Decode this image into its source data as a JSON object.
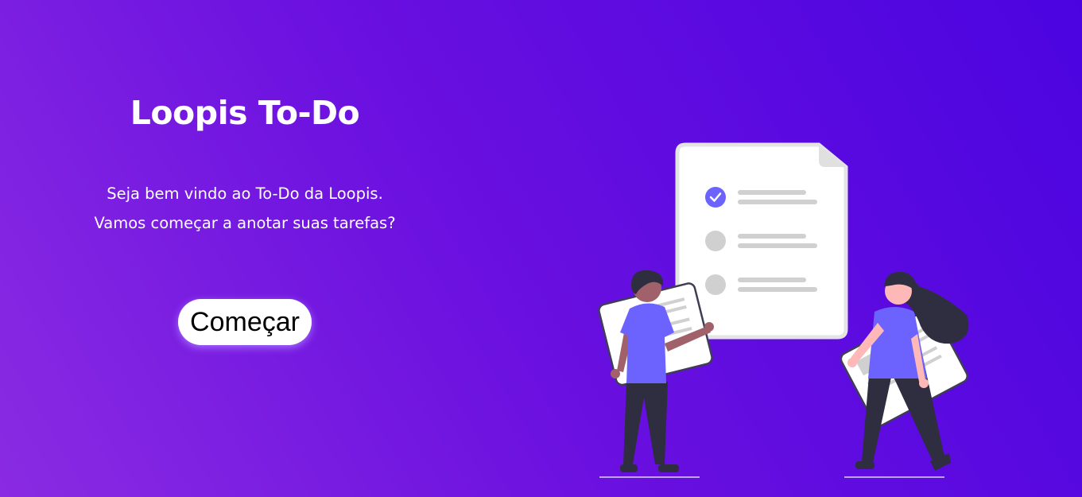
{
  "hero": {
    "title": "Loopis To-Do",
    "subtitle": "Seja bem vindo ao To-Do da Loopis. Vamos começar a anotar suas tarefas?",
    "start_button_label": "Começar"
  },
  "colors": {
    "gradient_start": "#8a2be2",
    "gradient_end": "#4b04e0",
    "accent": "#6c63ff",
    "dark": "#2f2e41"
  },
  "illustration": {
    "icon": "people-with-todo-checklist-illustration"
  }
}
